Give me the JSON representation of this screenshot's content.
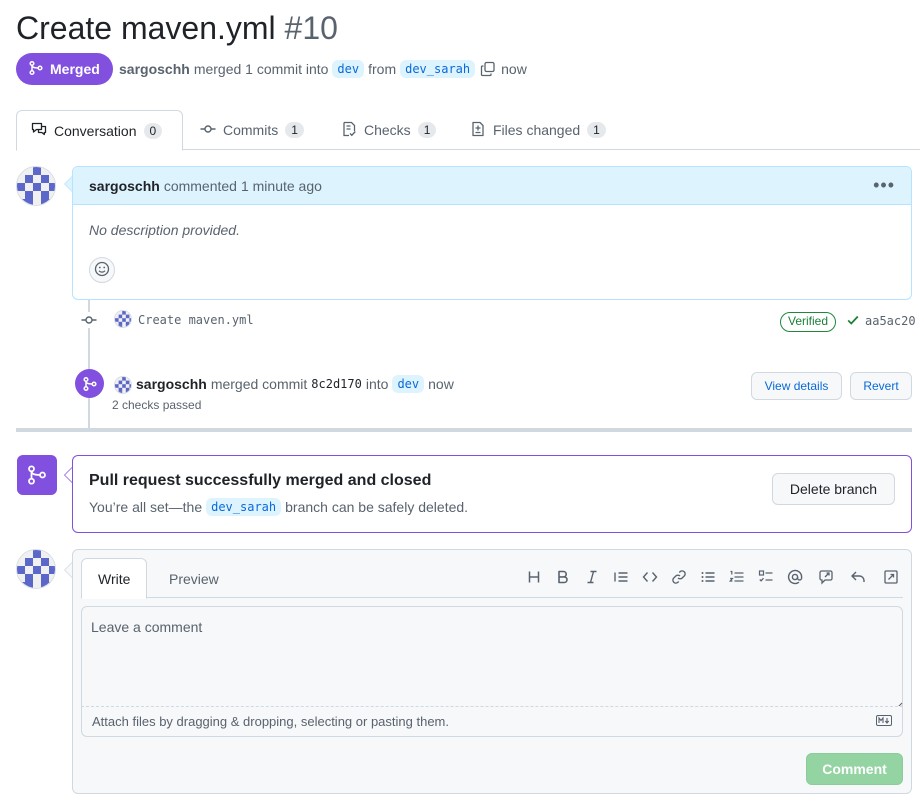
{
  "pr": {
    "title": "Create maven.yml",
    "number": "#10",
    "state_label": "Merged",
    "author": "sargoschh",
    "merge_text": "merged 1 commit into",
    "base_branch": "dev",
    "from_text": "from",
    "head_branch": "dev_sarah",
    "time": "now"
  },
  "tabs": [
    {
      "label": "Conversation",
      "count": "0",
      "icon": "comment-discussion-icon"
    },
    {
      "label": "Commits",
      "count": "1",
      "icon": "git-commit-icon"
    },
    {
      "label": "Checks",
      "count": "1",
      "icon": "checklist-icon"
    },
    {
      "label": "Files changed",
      "count": "1",
      "icon": "file-diff-icon"
    }
  ],
  "comment": {
    "author": "sargoschh",
    "action": "commented",
    "time": "1 minute ago",
    "body": "No description provided."
  },
  "commit": {
    "message": "Create maven.yml",
    "badge": "Verified",
    "sha": "aa5ac20"
  },
  "merge_event": {
    "author": "sargoschh",
    "action": "merged commit",
    "sha": "8c2d170",
    "into": "into",
    "branch": "dev",
    "time": "now",
    "checks": "2 checks passed",
    "view_details": "View details",
    "revert": "Revert"
  },
  "merged_box": {
    "title": "Pull request successfully merged and closed",
    "sub_before": "You’re all set—the",
    "branch": "dev_sarah",
    "sub_after": "branch can be safely deleted.",
    "delete_button": "Delete branch"
  },
  "editor": {
    "write_tab": "Write",
    "preview_tab": "Preview",
    "placeholder": "Leave a comment",
    "attach_text": "Attach files by dragging & dropping, selecting or pasting them.",
    "submit": "Comment",
    "toolbar": [
      "heading-icon",
      "bold-icon",
      "italic-icon",
      "quote-icon",
      "code-icon",
      "link-icon",
      "unordered-list-icon",
      "ordered-list-icon",
      "task-list-icon",
      "mention-icon",
      "cross-reference-icon",
      "reply-icon",
      "fullscreen-icon"
    ]
  },
  "colors": {
    "merged": "#8250df",
    "link": "#0969da",
    "comment_header": "#ddf4ff",
    "success_disabled": "#94d3a2"
  }
}
